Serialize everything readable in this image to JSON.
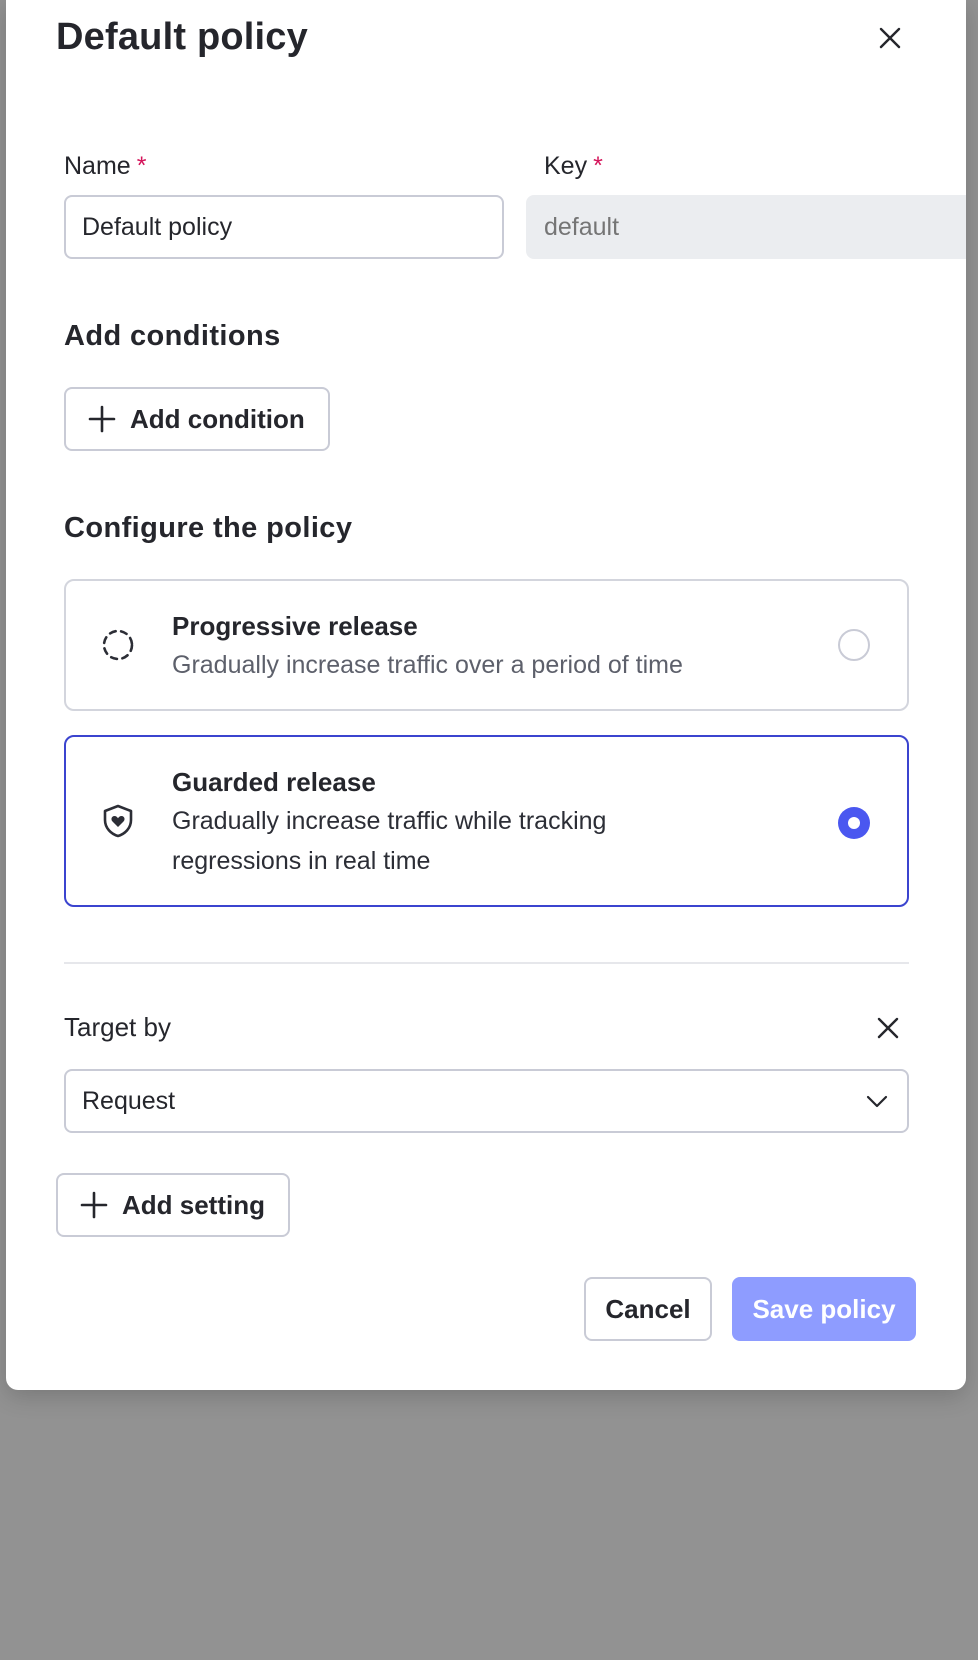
{
  "dialog": {
    "title": "Default policy"
  },
  "fields": {
    "name": {
      "label": "Name",
      "required_mark": "*",
      "value": "Default policy"
    },
    "key": {
      "label": "Key",
      "required_mark": "*",
      "placeholder": "default"
    }
  },
  "conditions": {
    "heading": "Add conditions",
    "add_button": "Add condition"
  },
  "configure": {
    "heading": "Configure the policy",
    "options": [
      {
        "title": "Progressive release",
        "description": "Gradually increase traffic over a period of time",
        "icon": "progress-circle-icon",
        "selected": false
      },
      {
        "title": "Guarded release",
        "description": "Gradually increase traffic while tracking regressions in real time",
        "icon": "shield-heart-icon",
        "selected": true
      }
    ]
  },
  "target": {
    "label": "Target by",
    "selected": "Request"
  },
  "settings": {
    "add_button": "Add setting"
  },
  "footer": {
    "cancel_label": "Cancel",
    "save_label": "Save policy"
  },
  "colors": {
    "accent": "#3b44cf",
    "radio_checked": "#4a57f0",
    "save_disabled": "#8e9cff",
    "required": "#d4145a"
  }
}
